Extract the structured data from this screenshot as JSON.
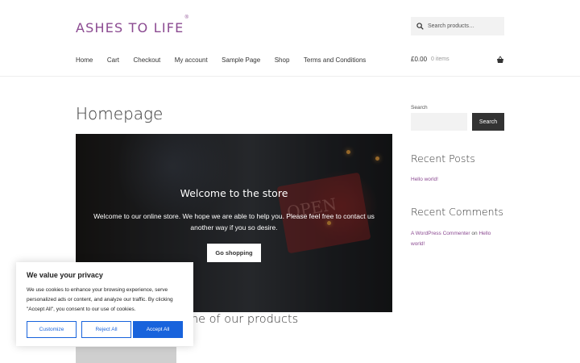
{
  "site": {
    "logo_text": "ASHES TO LIFE",
    "logo_mark": "®",
    "brand_color": "#8b4a91"
  },
  "header": {
    "search_placeholder": "Search products…",
    "nav": [
      "Home",
      "Cart",
      "Checkout",
      "My account",
      "Sample Page",
      "Shop",
      "Terms and Conditions"
    ],
    "cart_amount": "£0.00",
    "cart_items": "0 items"
  },
  "main": {
    "page_title": "Homepage",
    "hero": {
      "title": "Welcome to the store",
      "text": "Welcome to our online store. We hope we are able to help you. Please feel free to contact us another way if you so desire.",
      "button": "Go shopping"
    },
    "section_title": "me of our products"
  },
  "sidebar": {
    "search_label": "Search",
    "search_button": "Search",
    "recent_posts_title": "Recent Posts",
    "recent_posts": [
      "Hello world!"
    ],
    "recent_comments_title": "Recent Comments",
    "comment_author": "A WordPress Commenter",
    "comment_on": "on",
    "comment_post": "Hello world!"
  },
  "cookie": {
    "title": "We value your privacy",
    "text": "We use cookies to enhance your browsing experience, serve personalized ads or content, and analyze our traffic. By clicking \"Accept All\", you consent to our use of cookies.",
    "customize": "Customize",
    "reject": "Reject All",
    "accept": "Accept All",
    "accent_color": "#1863dc"
  },
  "icons": {
    "search": "search-icon",
    "cart": "basket-icon"
  }
}
